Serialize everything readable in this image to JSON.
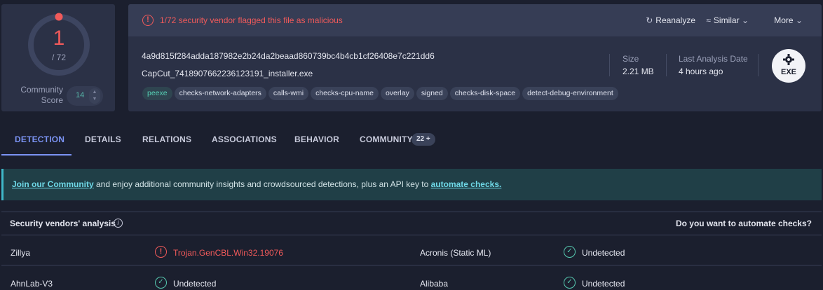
{
  "score": {
    "detections": "1",
    "total": "/ 72",
    "community_label_line1": "Community",
    "community_label_line2": "Score",
    "community_value": "14",
    "detection_ratio": 0.0139
  },
  "alert": {
    "text": "1/72 security vendor flagged this file as malicious",
    "icon": "alert-circle-icon"
  },
  "actions": {
    "reanalyze": "Reanalyze",
    "similar": "Similar",
    "more": "More"
  },
  "file": {
    "hash": "4a9d815f284adda187982e2b24da2beaad860739bc4b4cb1cf26408e7c221dd6",
    "name": "CapCut_7418907662236123191_installer.exe",
    "tags": [
      "peexe",
      "checks-network-adapters",
      "calls-wmi",
      "checks-cpu-name",
      "overlay",
      "signed",
      "checks-disk-space",
      "detect-debug-environment"
    ],
    "size_label": "Size",
    "size_value": "2.21 MB",
    "last_analysis_label": "Last Analysis Date",
    "last_analysis_value": "4 hours ago",
    "type_badge": "EXE"
  },
  "tabs": [
    {
      "label": "DETECTION",
      "active": true
    },
    {
      "label": "DETAILS"
    },
    {
      "label": "RELATIONS"
    },
    {
      "label": "ASSOCIATIONS"
    },
    {
      "label": "BEHAVIOR"
    },
    {
      "label": "COMMUNITY",
      "badge": "22 +"
    }
  ],
  "banner": {
    "link1": "Join our Community",
    "middle": " and enjoy additional community insights and crowdsourced detections, plus an API key to ",
    "link2": "automate checks."
  },
  "analysis": {
    "title": "Security vendors' analysis",
    "automate_question": "Do you want to automate checks?",
    "rows": [
      {
        "left_vendor": "Zillya",
        "left_result": "Trojan.GenCBL.Win32.19076",
        "left_status": "malicious",
        "right_vendor": "Acronis (Static ML)",
        "right_result": "Undetected",
        "right_status": "undetected"
      },
      {
        "left_vendor": "AhnLab-V3",
        "left_result": "Undetected",
        "left_status": "undetected",
        "right_vendor": "Alibaba",
        "right_result": "Undetected",
        "right_status": "undetected"
      }
    ]
  },
  "colors": {
    "malicious": "#f15a5a",
    "clean": "#56c9b0",
    "accent": "#7b93f3",
    "background": "#1b1f2e",
    "card": "#2b3146"
  }
}
